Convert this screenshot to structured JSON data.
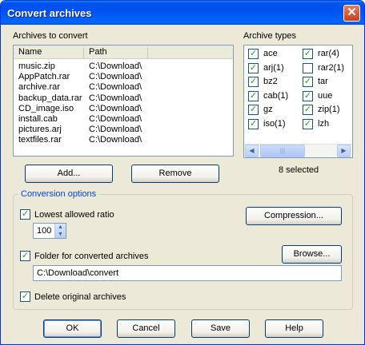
{
  "window": {
    "title": "Convert archives",
    "close_glyph": "✕"
  },
  "archives": {
    "label": "Archives to convert",
    "columns": [
      "Name",
      "Path"
    ],
    "rows": [
      {
        "name": "music.zip",
        "path": "C:\\Download\\"
      },
      {
        "name": "AppPatch.rar",
        "path": "C:\\Download\\"
      },
      {
        "name": "archive.rar",
        "path": "C:\\Download\\"
      },
      {
        "name": "backup_data.rar",
        "path": "C:\\Download\\"
      },
      {
        "name": "CD_image.iso",
        "path": "C:\\Download\\"
      },
      {
        "name": "install.cab",
        "path": "C:\\Download\\"
      },
      {
        "name": "pictures.arj",
        "path": "C:\\Download\\"
      },
      {
        "name": "textfiles.rar",
        "path": "C:\\Download\\"
      }
    ],
    "add_button": "Add...",
    "remove_button": "Remove"
  },
  "types": {
    "label": "Archive types",
    "items": [
      {
        "label": "ace",
        "checked": true
      },
      {
        "label": "rar(4)",
        "checked": true
      },
      {
        "label": "arj(1)",
        "checked": true
      },
      {
        "label": "rar2(1)",
        "checked": false
      },
      {
        "label": "bz2",
        "checked": true
      },
      {
        "label": "tar",
        "checked": true
      },
      {
        "label": "cab(1)",
        "checked": true
      },
      {
        "label": "uue",
        "checked": true
      },
      {
        "label": "gz",
        "checked": true
      },
      {
        "label": "zip(1)",
        "checked": true
      },
      {
        "label": "iso(1)",
        "checked": true
      },
      {
        "label": "lzh",
        "checked": true
      }
    ],
    "selected_text": "8 selected",
    "scroll_left_icon": "◀",
    "scroll_right_icon": "▶",
    "scroll_thumb_grip": "|||"
  },
  "options": {
    "group_label": "Conversion options",
    "lowest_ratio": {
      "label": "Lowest allowed ratio",
      "checked": true,
      "value": "100"
    },
    "compression_button": "Compression...",
    "folder": {
      "label": "Folder for converted archives",
      "checked": true,
      "value": "C:\\Download\\convert"
    },
    "browse_button": "Browse...",
    "delete_original": {
      "label": "Delete original archives",
      "checked": true
    }
  },
  "buttons": {
    "ok": "OK",
    "cancel": "Cancel",
    "save": "Save",
    "help": "Help"
  },
  "colors": {
    "title_bar": "#0054e3",
    "group_label": "#0046d5",
    "check_mark": "#21a121"
  }
}
